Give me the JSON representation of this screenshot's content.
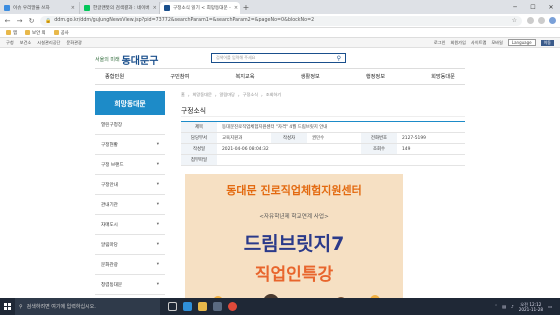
{
  "browser": {
    "tabs": [
      {
        "label": "이슈 우리말을 쓰자",
        "fav_color": "#3c8de0"
      },
      {
        "label": "한글맨뜻의 검색결과 : 네이버",
        "fav_color": "#03c75a"
      },
      {
        "label": "구정소식 읽기 < 희망동대문 -",
        "fav_color": "#1a4f8c",
        "active": true
      }
    ],
    "new_tab": "+",
    "url": "ddm.go.kr/ddm/guJungNewsView.jsp?pid=73772&searchParam1=&searchParam2=&pageNo=0&blockNo=2"
  },
  "bookmarks": [
    "앱",
    "보안 외",
    "공사"
  ],
  "utilbar": {
    "left": [
      "구청",
      "보건소",
      "시설관리공단",
      "문화관광"
    ],
    "right": [
      "로그인",
      "회원가입",
      "사이트맵",
      "모바일"
    ],
    "language": "Language",
    "lang_btn": "이동"
  },
  "header": {
    "logo_small": "서울의 미래",
    "logo_big": "동대문구",
    "search_placeholder": "검색어를 입력해 주세요"
  },
  "gnb": [
    "종합민원",
    "구민참여",
    "복지교육",
    "생활정보",
    "행정정보",
    "희망동대문"
  ],
  "lnb": {
    "title": "희망동대문",
    "items": [
      {
        "label": "열린구청장",
        "arrow": ""
      },
      {
        "label": "구정현황",
        "arrow": "▾"
      },
      {
        "label": "구정 브랜드",
        "arrow": "▾"
      },
      {
        "label": "구정안내",
        "arrow": "▾"
      },
      {
        "label": "관내기관",
        "arrow": "▾"
      },
      {
        "label": "자매도시",
        "arrow": "▾"
      },
      {
        "label": "알림마당",
        "arrow": "▾"
      },
      {
        "label": "문화관광",
        "arrow": "▾"
      },
      {
        "label": "청렴동대문",
        "arrow": "▾"
      }
    ]
  },
  "content": {
    "breadcrumb": [
      "홈",
      "희망동대문",
      "알림마당",
      "구정소식",
      "조회하기"
    ],
    "page_title": "구정소식",
    "board": {
      "subject_label": "제목",
      "subject_value": "동대문진로직업체험지원센터 \"자격\" 4월 드림브릿지 안내",
      "dept_label": "담당부서",
      "dept_value": "교육지원과",
      "author_label": "작성자",
      "author_value": "권민수",
      "phone_label": "전화번호",
      "phone_value": "2127-5199",
      "date_label": "작성일",
      "date_value": "2021-04-06 08:04:32",
      "views_label": "조회수",
      "views_value": "149",
      "attach_label": "첨부파일"
    },
    "poster": {
      "line1": "동대문 진로직업체험지원센터",
      "line2": "<자유학년제 학교연계 사업>",
      "line3": "드림브릿지7",
      "line4": "직업인특강"
    }
  },
  "taskbar": {
    "search_placeholder": "검색하려면 여기에 입력하십시오.",
    "time": "오전 12:12",
    "date": "2021-11-28"
  }
}
